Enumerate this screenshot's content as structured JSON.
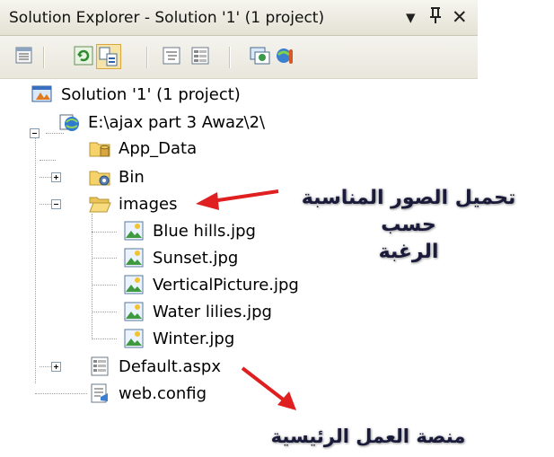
{
  "window": {
    "title": "Solution Explorer - Solution '1' (1 project)",
    "controls": {
      "dropdown": "▾",
      "pin": "ꟸ",
      "close": "✕"
    }
  },
  "toolbar": {
    "buttons": [
      {
        "icon": "properties-icon"
      },
      {
        "icon": "refresh-icon"
      },
      {
        "icon": "nest-related-files-icon",
        "active": true
      },
      {
        "icon": "view-code-icon"
      },
      {
        "icon": "view-designer-icon"
      },
      {
        "icon": "copy-website-icon"
      },
      {
        "icon": "asp-net-configuration-icon"
      }
    ]
  },
  "tree": {
    "solution": "Solution '1' (1 project)",
    "project": "E:\\ajax part 3 Awaz\\2\\",
    "items": {
      "app_data": "App_Data",
      "bin": "Bin",
      "images": "images",
      "image_files": [
        "Blue hills.jpg",
        "Sunset.jpg",
        "VerticalPicture.jpg",
        "Water lilies.jpg",
        "Winter.jpg"
      ],
      "default_aspx": "Default.aspx",
      "web_config": "web.config"
    }
  },
  "annotations": {
    "images_note_line1": "تحميل الصور المناسبة حسب",
    "images_note_line2": "الرغبة",
    "default_note": "منصة العمل الرئيسية"
  },
  "colors": {
    "arrow": "#e02020",
    "selection": "#f6e3a8"
  }
}
